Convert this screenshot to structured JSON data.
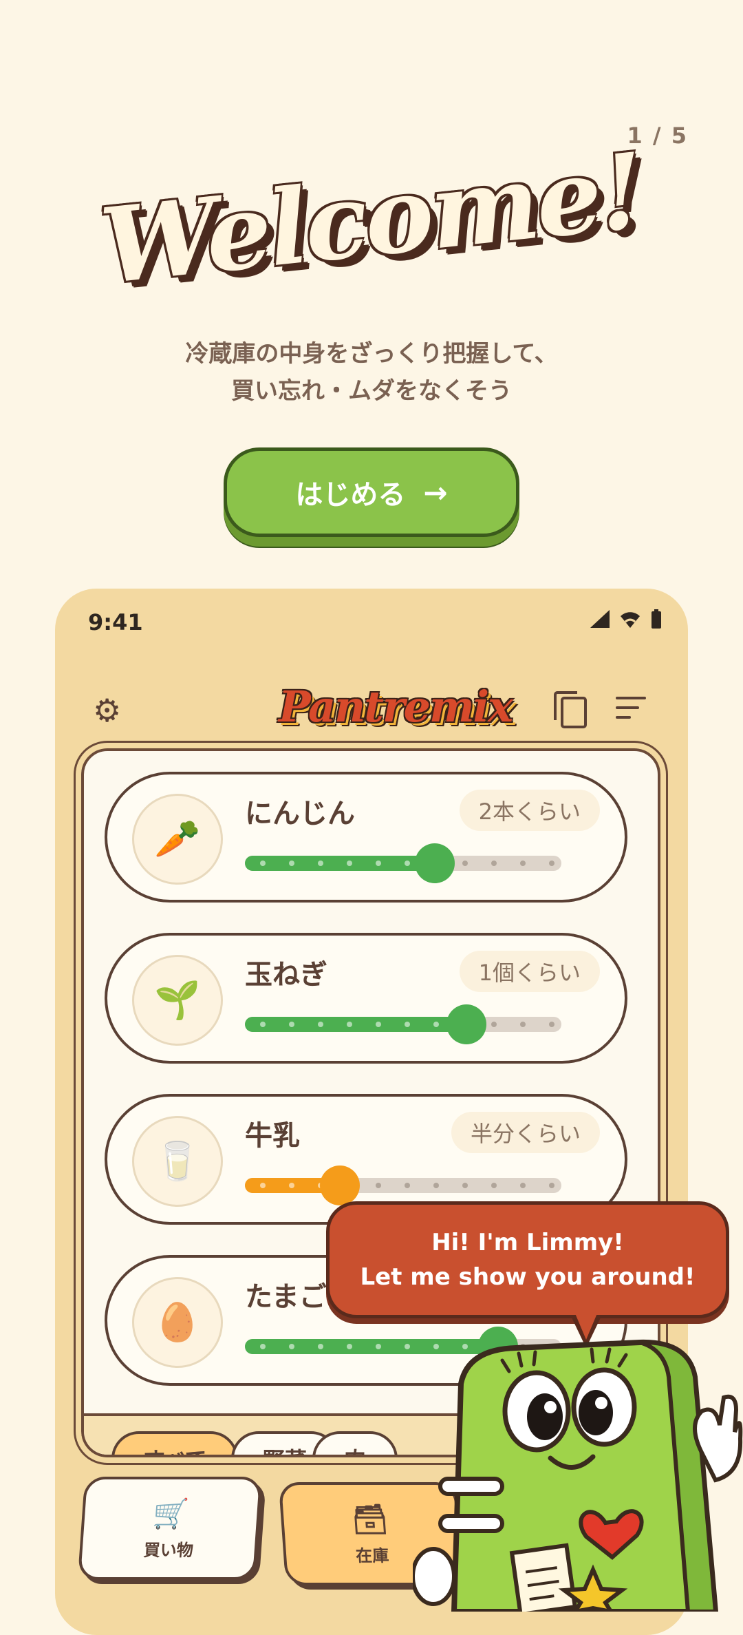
{
  "onboarding": {
    "page_counter": "1 / 5",
    "welcome_title": "Welcome!",
    "subtitle_line1": "冷蔵庫の中身をざっくり把握して、",
    "subtitle_line2": "買い忘れ・ムダをなくそう",
    "start_button_label": "はじめる",
    "start_button_arrow": "→"
  },
  "phone": {
    "status_time": "9:41",
    "app_logo": "Pantremix",
    "items": [
      {
        "name": "にんじん",
        "amount": "2本くらい",
        "icon": "carrot-icon",
        "glyph": "🥕",
        "level": 0.6,
        "color": "#4caf50"
      },
      {
        "name": "玉ねぎ",
        "amount": "1個くらい",
        "icon": "green-onion-icon",
        "glyph": "🌱",
        "level": 0.7,
        "color": "#4caf50"
      },
      {
        "name": "牛乳",
        "amount": "半分くらい",
        "icon": "milk-carton-icon",
        "glyph": "🥛",
        "level": 0.3,
        "color": "#f59c1a"
      },
      {
        "name": "たまご",
        "amount": "",
        "icon": "egg-icon",
        "glyph": "🥚",
        "level": 0.8,
        "color": "#4caf50"
      }
    ],
    "filters": [
      "すべて",
      "野菜",
      "肉"
    ],
    "nav": {
      "shopping_label": "買い物",
      "stock_label": "在庫"
    }
  },
  "mascot": {
    "speech_line1": "Hi! I'm Limmy!",
    "speech_line2": "Let me show you around!"
  },
  "colors": {
    "background": "#fdf6e6",
    "accent_green": "#8bc34a",
    "brown": "#5a4034",
    "bubble": "#c9502f",
    "chip_active": "#ffcc7a"
  }
}
